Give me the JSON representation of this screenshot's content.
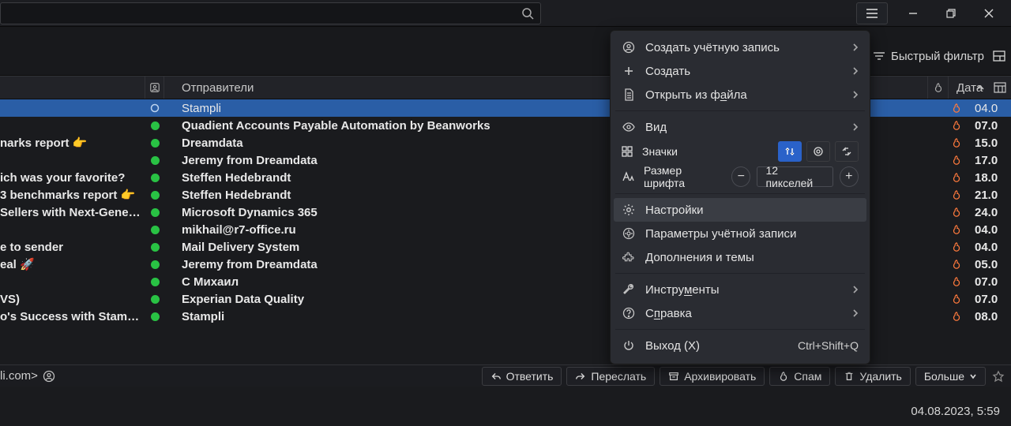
{
  "toolbar": {
    "quick_filter": "Быстрый фильтр"
  },
  "columns": {
    "senders": "Отправители",
    "date": "Дата"
  },
  "messages": [
    {
      "subject": "",
      "sender": "Stampli",
      "date": "04.0",
      "unread": false,
      "selected": true
    },
    {
      "subject": "",
      "sender": "Quadient Accounts Payable Automation by Beanworks",
      "date": "07.0",
      "unread": true,
      "selected": false
    },
    {
      "subject": "narks report 👉",
      "sender": "Dreamdata",
      "date": "15.0",
      "unread": true,
      "selected": false
    },
    {
      "subject": "",
      "sender": "Jeremy from Dreamdata",
      "date": "17.0",
      "unread": true,
      "selected": false
    },
    {
      "subject": "ich was your favorite?",
      "sender": "Steffen Hedebrandt",
      "date": "18.0",
      "unread": true,
      "selected": false
    },
    {
      "subject": "3 benchmarks report 👉",
      "sender": "Steffen Hedebrandt",
      "date": "21.0",
      "unread": true,
      "selected": false
    },
    {
      "subject": "Sellers with Next-Genera...",
      "sender": "Microsoft Dynamics 365",
      "date": "24.0",
      "unread": true,
      "selected": false
    },
    {
      "subject": "",
      "sender": "mikhail@r7-office.ru",
      "date": "04.0",
      "unread": true,
      "selected": false
    },
    {
      "subject": "e to sender",
      "sender": "Mail Delivery System",
      "date": "04.0",
      "unread": true,
      "selected": false
    },
    {
      "subject": "eal 🚀",
      "sender": "Jeremy from Dreamdata",
      "date": "05.0",
      "unread": true,
      "selected": false
    },
    {
      "subject": "",
      "sender": "С Михаил",
      "date": "07.0",
      "unread": true,
      "selected": false
    },
    {
      "subject": "VS)",
      "sender": "Experian Data Quality",
      "date": "07.0",
      "unread": true,
      "selected": false
    },
    {
      "subject": "o's Success with Stampli'...",
      "sender": "Stampli",
      "date": "08.0",
      "unread": true,
      "selected": false
    }
  ],
  "preview": {
    "from_fragment": "li.com>"
  },
  "reply_buttons": {
    "reply": "Ответить",
    "forward": "Переслать",
    "archive": "Архивировать",
    "spam": "Спам",
    "delete": "Удалить",
    "more": "Больше"
  },
  "statusbar": {
    "datetime": "04.08.2023, 5:59"
  },
  "menu": {
    "create_account": "Создать учётную запись",
    "create": "Создать",
    "open_from_file_pre": "Открыть из ф",
    "open_from_file_u": "а",
    "open_from_file_post": "йла",
    "view": "Вид",
    "icons": "Значки",
    "font_size": "Размер шрифта",
    "font_value": "12 пикселей",
    "settings": "Настройки",
    "account_params": "Параметры учётной записи",
    "addons_themes": "Дополнения и темы",
    "tools_pre": "Инстру",
    "tools_u": "м",
    "tools_post": "енты",
    "help_pre": "С",
    "help_u": "п",
    "help_post": "равка",
    "exit": "Выход (X)",
    "exit_shortcut": "Ctrl+Shift+Q"
  }
}
